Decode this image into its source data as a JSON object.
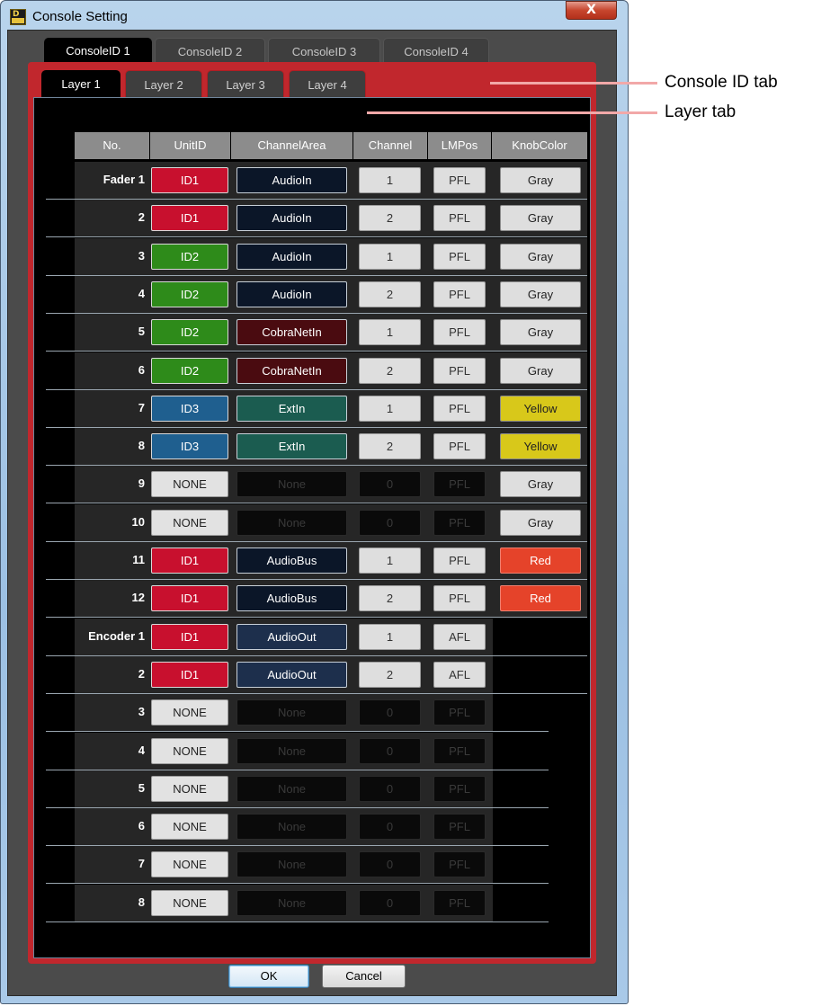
{
  "window": {
    "title": "Console Setting",
    "close_label": "X"
  },
  "console_tabs": [
    "ConsoleID 1",
    "ConsoleID 2",
    "ConsoleID 3",
    "ConsoleID 4"
  ],
  "layer_tabs": [
    "Layer 1",
    "Layer 2",
    "Layer 3",
    "Layer 4"
  ],
  "columns": [
    "No.",
    "UnitID",
    "ChannelArea",
    "Channel",
    "LMPos",
    "KnobColor"
  ],
  "rows": [
    {
      "group": "Fader",
      "no": "1",
      "unit": "ID1",
      "area": "AudioIn",
      "ch": "1",
      "lm": "PFL",
      "knob": "Gray"
    },
    {
      "no": "2",
      "unit": "ID1",
      "area": "AudioIn",
      "ch": "2",
      "lm": "PFL",
      "knob": "Gray"
    },
    {
      "no": "3",
      "unit": "ID2",
      "area": "AudioIn",
      "ch": "1",
      "lm": "PFL",
      "knob": "Gray"
    },
    {
      "no": "4",
      "unit": "ID2",
      "area": "AudioIn",
      "ch": "2",
      "lm": "PFL",
      "knob": "Gray"
    },
    {
      "no": "5",
      "unit": "ID2",
      "area": "CobraNetIn",
      "ch": "1",
      "lm": "PFL",
      "knob": "Gray"
    },
    {
      "no": "6",
      "unit": "ID2",
      "area": "CobraNetIn",
      "ch": "2",
      "lm": "PFL",
      "knob": "Gray"
    },
    {
      "no": "7",
      "unit": "ID3",
      "area": "ExtIn",
      "ch": "1",
      "lm": "PFL",
      "knob": "Yellow"
    },
    {
      "no": "8",
      "unit": "ID3",
      "area": "ExtIn",
      "ch": "2",
      "lm": "PFL",
      "knob": "Yellow"
    },
    {
      "no": "9",
      "unit": "NONE",
      "area": "None",
      "ch": "0",
      "lm": "PFL",
      "knob": "Gray"
    },
    {
      "no": "10",
      "unit": "NONE",
      "area": "None",
      "ch": "0",
      "lm": "PFL",
      "knob": "Gray"
    },
    {
      "no": "11",
      "unit": "ID1",
      "area": "AudioBus",
      "ch": "1",
      "lm": "PFL",
      "knob": "Red"
    },
    {
      "no": "12",
      "unit": "ID1",
      "area": "AudioBus",
      "ch": "2",
      "lm": "PFL",
      "knob": "Red"
    },
    {
      "group": "Encoder",
      "no": "1",
      "unit": "ID1",
      "area": "AudioOut",
      "ch": "1",
      "lm": "AFL",
      "knob": ""
    },
    {
      "no": "2",
      "unit": "ID1",
      "area": "AudioOut",
      "ch": "2",
      "lm": "AFL",
      "knob": ""
    },
    {
      "no": "3",
      "unit": "NONE",
      "area": "None",
      "ch": "0",
      "lm": "PFL",
      "knob": ""
    },
    {
      "no": "4",
      "unit": "NONE",
      "area": "None",
      "ch": "0",
      "lm": "PFL",
      "knob": ""
    },
    {
      "no": "5",
      "unit": "NONE",
      "area": "None",
      "ch": "0",
      "lm": "PFL",
      "knob": ""
    },
    {
      "no": "6",
      "unit": "NONE",
      "area": "None",
      "ch": "0",
      "lm": "PFL",
      "knob": ""
    },
    {
      "no": "7",
      "unit": "NONE",
      "area": "None",
      "ch": "0",
      "lm": "PFL",
      "knob": ""
    },
    {
      "no": "8",
      "unit": "NONE",
      "area": "None",
      "ch": "0",
      "lm": "PFL",
      "knob": ""
    }
  ],
  "buttons": {
    "ok": "OK",
    "cancel": "Cancel"
  },
  "callouts": {
    "console_id_tab": "Console ID tab",
    "layer_tab": "Layer tab"
  },
  "colors": {
    "ID1": "#c8102e",
    "ID2": "#2e8b1a",
    "ID3": "#1f5f8f",
    "NONE": "#e2e2e2",
    "AudioIn": "#0b1628",
    "CobraNetIn": "#4a0b10",
    "ExtIn": "#1b5c50",
    "AudioBus": "#0b1628",
    "AudioOut": "#1d2f4c",
    "None": "#0a0a0a",
    "Gray": "#dedede",
    "Yellow": "#d8c81a",
    "Red": "#e5432a"
  }
}
